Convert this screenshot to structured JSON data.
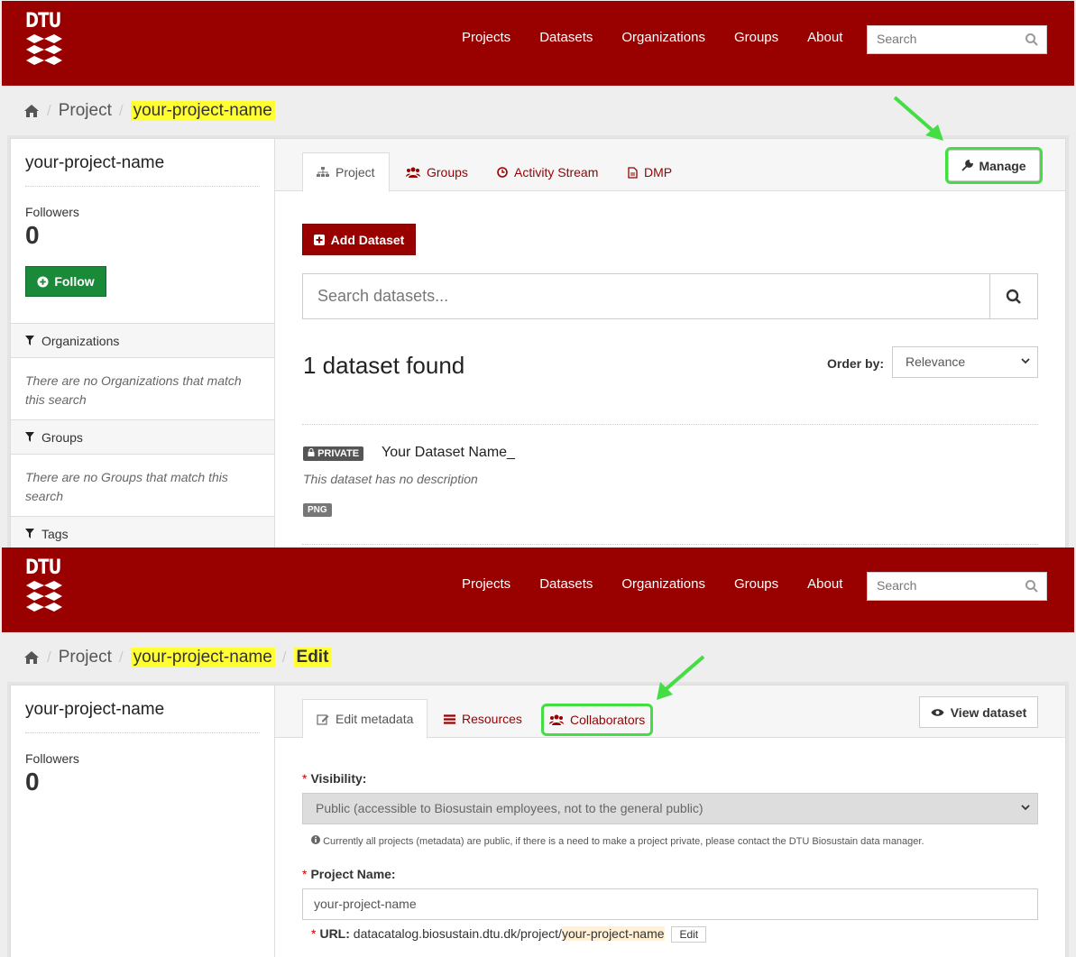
{
  "top": {
    "logo_text": "DTU",
    "nav": [
      "Projects",
      "Datasets",
      "Organizations",
      "Groups",
      "About"
    ],
    "search_placeholder": "Search"
  },
  "shot1": {
    "breadcrumb": {
      "section": "Project",
      "current": "your-project-name"
    },
    "sidebar": {
      "title": "your-project-name",
      "followers_label": "Followers",
      "followers_count": "0",
      "follow_button": "Follow",
      "facets": [
        {
          "title": "Organizations",
          "empty": "There are no Organizations that match this search"
        },
        {
          "title": "Groups",
          "empty": "There are no Groups that match this search"
        },
        {
          "title": "Tags"
        }
      ]
    },
    "tabs": [
      "Project",
      "Groups",
      "Activity Stream",
      "DMP"
    ],
    "manage_button": "Manage",
    "add_dataset_button": "Add Dataset",
    "dataset_search_placeholder": "Search datasets...",
    "results_count": "1 dataset found",
    "order_by_label": "Order by:",
    "order_by_value": "Relevance",
    "dataset": {
      "badge": "PRIVATE",
      "name": "Your Dataset Name_",
      "description": "This dataset has no description",
      "format": "PNG"
    }
  },
  "shot2": {
    "breadcrumb": {
      "section": "Project",
      "current": "your-project-name",
      "action": "Edit"
    },
    "sidebar": {
      "title": "your-project-name",
      "followers_label": "Followers",
      "followers_count": "0"
    },
    "tabs": [
      "Edit metadata",
      "Resources",
      "Collaborators"
    ],
    "view_button": "View dataset",
    "visibility_label": "Visibility:",
    "visibility_value": "Public (accessible to Biosustain employees, not to the general public)",
    "visibility_help": "Currently all projects (metadata) are public, if there is a need to make a project private, please contact the DTU Biosustain data manager.",
    "name_label": "Project Name:",
    "name_value": "your-project-name",
    "url_label": "URL:",
    "url_prefix": "datacatalog.biosustain.dtu.dk/project/",
    "url_slug": "your-project-name",
    "url_edit_button": "Edit"
  },
  "colors": {
    "brand": "#990000",
    "highlight": "#ffff33",
    "annotation": "#44dd44",
    "follow": "#1a8a3a"
  }
}
